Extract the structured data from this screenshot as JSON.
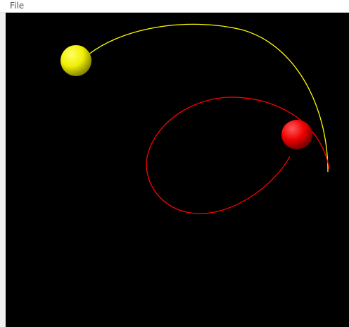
{
  "menu": {
    "file_label": "File"
  },
  "scene": {
    "background": "#000000",
    "bodies": [
      {
        "name": "yellow-sphere",
        "color": "#ffff00"
      },
      {
        "name": "red-sphere",
        "color": "#ff0000"
      }
    ],
    "orbits": [
      {
        "name": "yellow-orbit-trail",
        "color": "#ffff00"
      },
      {
        "name": "red-orbit-trail",
        "color": "#ff0000"
      }
    ]
  }
}
